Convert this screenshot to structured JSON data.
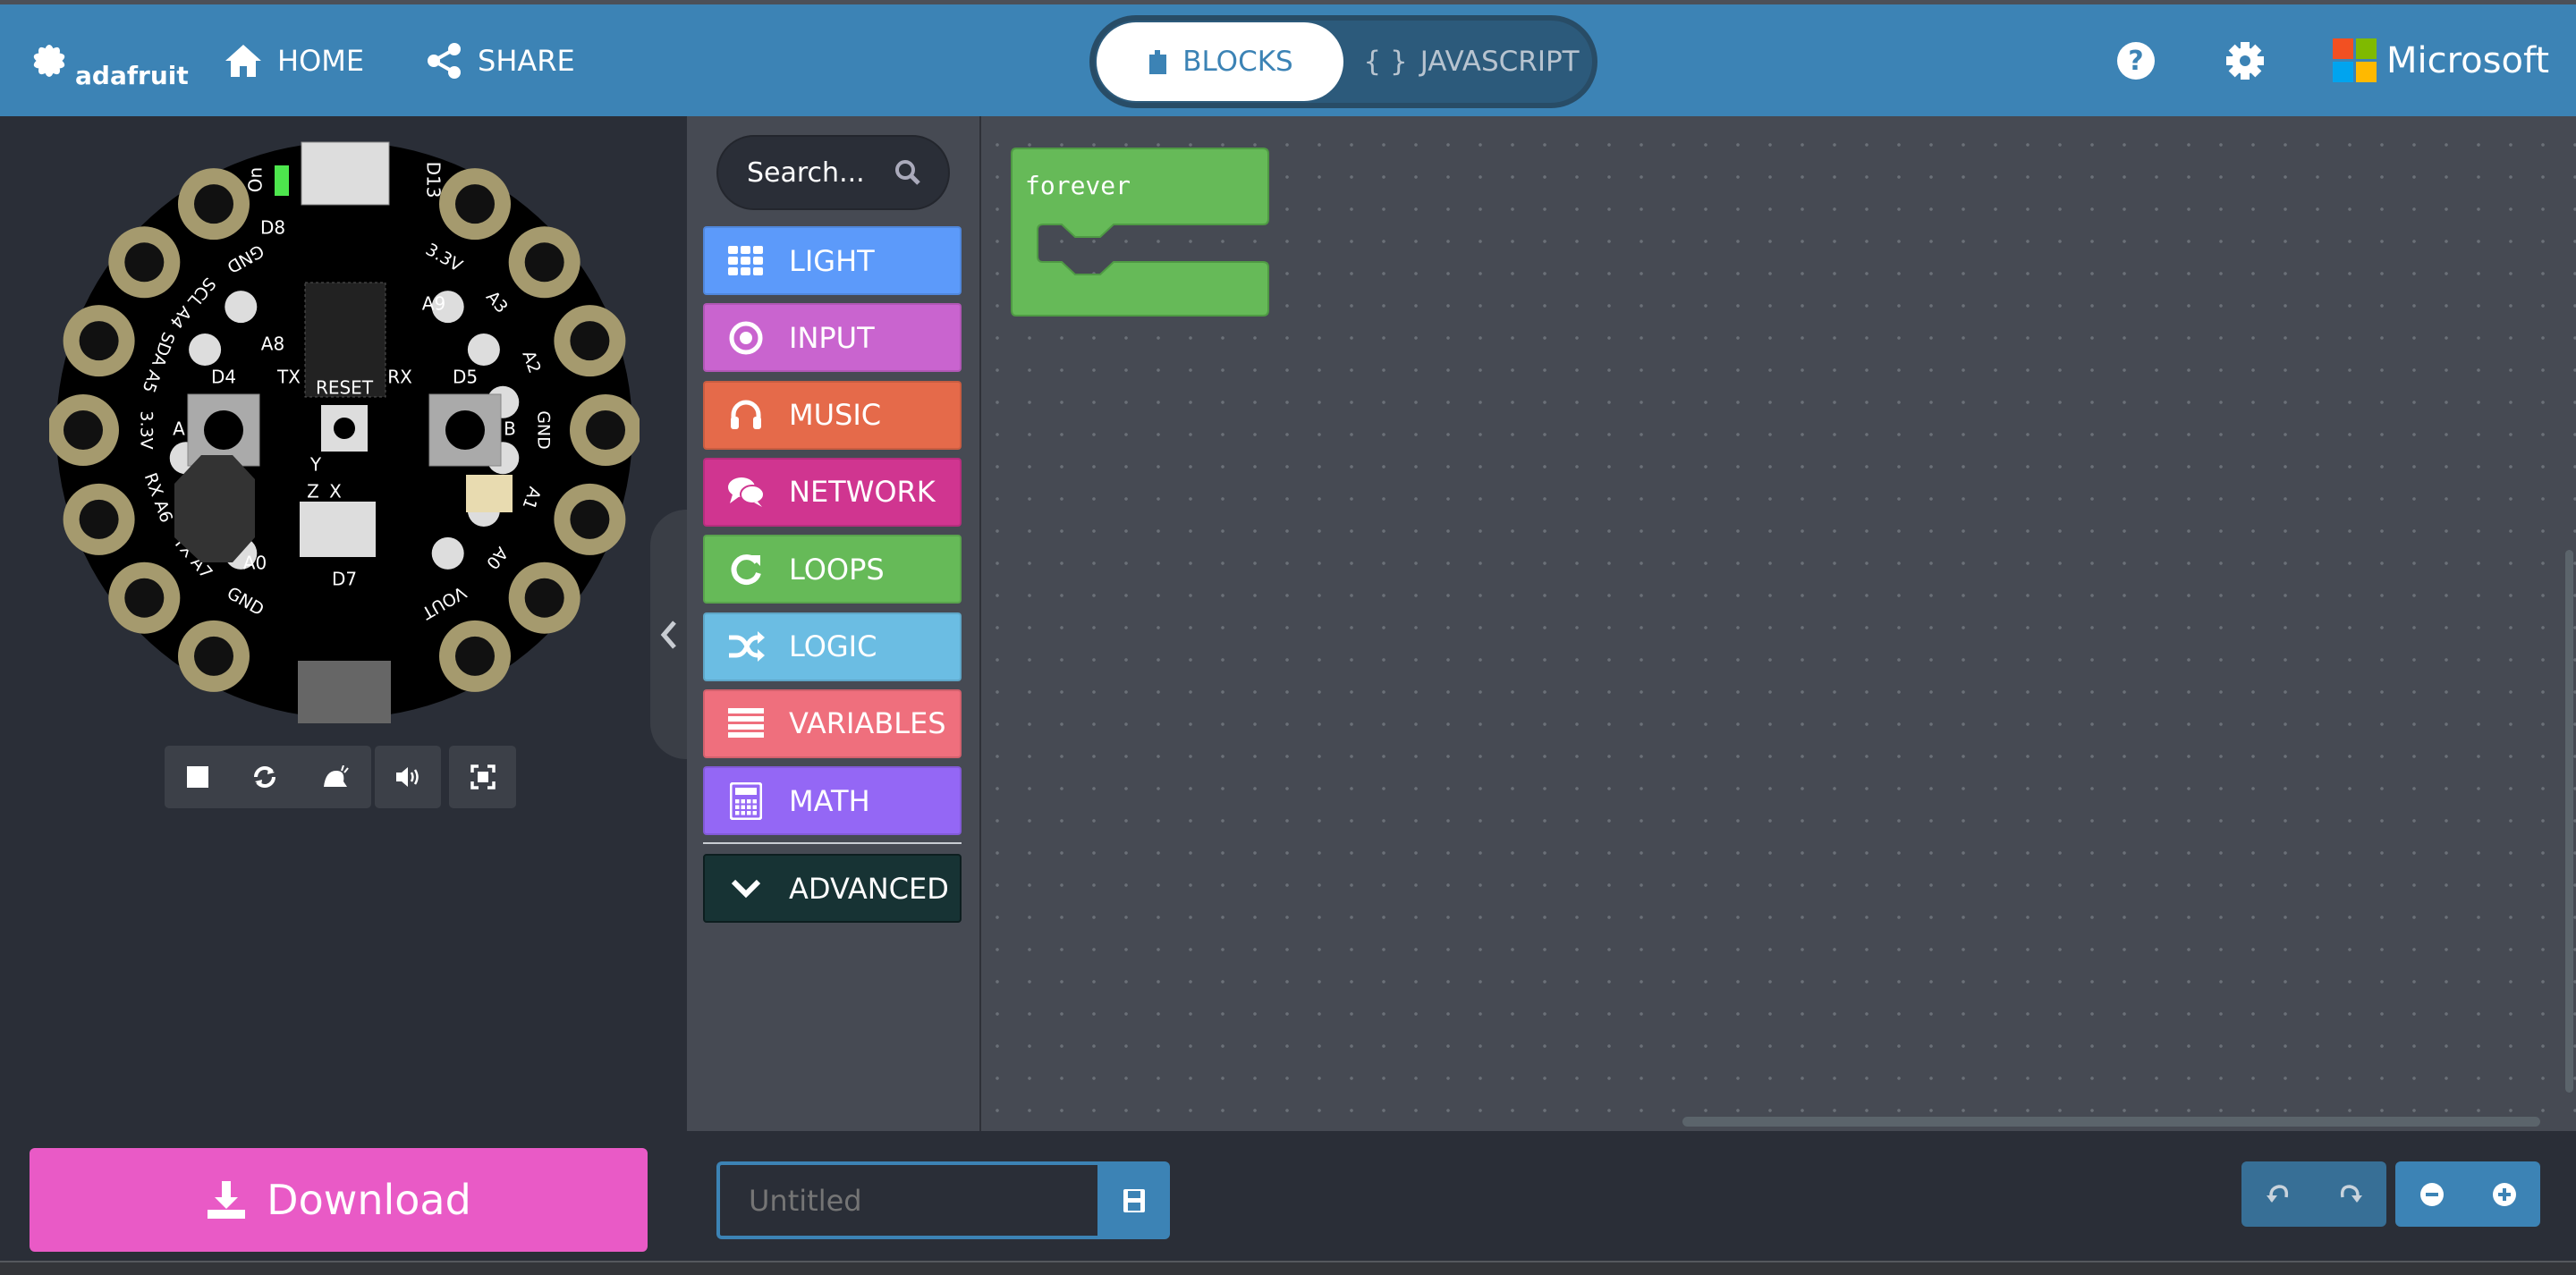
{
  "header": {
    "brand": "adafruit",
    "home_label": "HOME",
    "share_label": "SHARE",
    "blocks_label": "BLOCKS",
    "javascript_label": "JAVASCRIPT",
    "javascript_icon": "{ }",
    "microsoft_label": "Microsoft",
    "help_icon": "help-circle-icon",
    "settings_icon": "gear-icon",
    "colors": {
      "header": "#3c83b5",
      "ms_red": "#f25022",
      "ms_green": "#7fba00",
      "ms_blue": "#00a4ef",
      "ms_yellow": "#ffb900"
    }
  },
  "board": {
    "left_pads": [
      "GND",
      "SCL A4",
      "SDA A5",
      "3.3V",
      "RX A6",
      "TX A7",
      "GND"
    ],
    "right_pads": [
      "3.3V",
      "A3",
      "A2",
      "GND",
      "A1",
      "A0",
      "VOUT"
    ],
    "labels": {
      "on": "On",
      "d13": "D13",
      "d8": "D8",
      "a8": "A8",
      "a9": "A9",
      "d4": "D4",
      "tx": "TX",
      "reset": "RESET",
      "rx": "RX",
      "d5": "D5",
      "a": "A",
      "b": "B",
      "y": "Y",
      "z": "Z",
      "x": "X",
      "a0": "A0",
      "d7": "D7"
    }
  },
  "sim_controls": [
    "stop-icon",
    "restart-icon",
    "slow-motion-icon",
    "volume-icon",
    "fullscreen-icon"
  ],
  "toolbox": {
    "search_placeholder": "Search...",
    "categories": [
      {
        "label": "LIGHT",
        "color": "#5c9afa",
        "icon": "grid-icon"
      },
      {
        "label": "INPUT",
        "color": "#c964cf",
        "icon": "target-icon"
      },
      {
        "label": "MUSIC",
        "color": "#e56a4a",
        "icon": "headphones-icon"
      },
      {
        "label": "NETWORK",
        "color": "#d03590",
        "icon": "chat-icon"
      },
      {
        "label": "LOOPS",
        "color": "#66ba58",
        "icon": "refresh-icon"
      },
      {
        "label": "LOGIC",
        "color": "#6bbde3",
        "icon": "shuffle-icon"
      },
      {
        "label": "VARIABLES",
        "color": "#ef6f7d",
        "icon": "list-icon"
      },
      {
        "label": "MATH",
        "color": "#9467f5",
        "icon": "calculator-icon"
      }
    ],
    "advanced_label": "ADVANCED"
  },
  "workspace": {
    "blocks": [
      {
        "label": "forever",
        "color": "#66ba58"
      }
    ]
  },
  "footer": {
    "download_label": "Download",
    "download_color": "#e95ac6",
    "project_name": "",
    "project_placeholder": "Untitled"
  }
}
